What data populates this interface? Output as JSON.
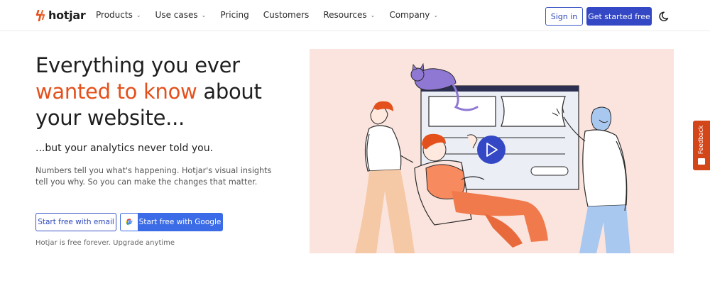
{
  "header": {
    "logo_text": "hotjar",
    "nav_items": [
      {
        "label": "Products",
        "has_dropdown": true
      },
      {
        "label": "Use cases",
        "has_dropdown": true
      },
      {
        "label": "Pricing",
        "has_dropdown": false
      },
      {
        "label": "Customers",
        "has_dropdown": false
      },
      {
        "label": "Resources",
        "has_dropdown": true
      },
      {
        "label": "Company",
        "has_dropdown": true
      }
    ],
    "dropdown_glyph": "⌄",
    "sign_in_label": "Sign in",
    "get_started_label": "Get started free",
    "theme_icon": "moon-icon"
  },
  "hero": {
    "headline_line1": "Everything you ever",
    "headline_accent": "wanted to know",
    "headline_line2_rest": " about",
    "headline_line3": "your website...",
    "subheadline": "...but your analytics never told you.",
    "body": "Numbers tell you what's happening. Hotjar's visual insights tell you why. So you can make the changes that matter.",
    "cta_email_label": "Start free with email",
    "cta_google_label": "Start free with Google",
    "footnote": "Hotjar is free forever. Upgrade anytime"
  },
  "feedback_tab": {
    "label": "Feedback"
  },
  "colors": {
    "brand_orange": "#e4501b",
    "primary_blue": "#3448c5",
    "google_blue": "#3b6be6",
    "illustration_bg": "#fbe4dd",
    "feedback_bg": "#d3461a"
  },
  "icons": [
    "hotjar-logo-icon",
    "chevron-down-icon",
    "moon-icon",
    "google-g-icon",
    "play-icon",
    "feedback-icon"
  ]
}
